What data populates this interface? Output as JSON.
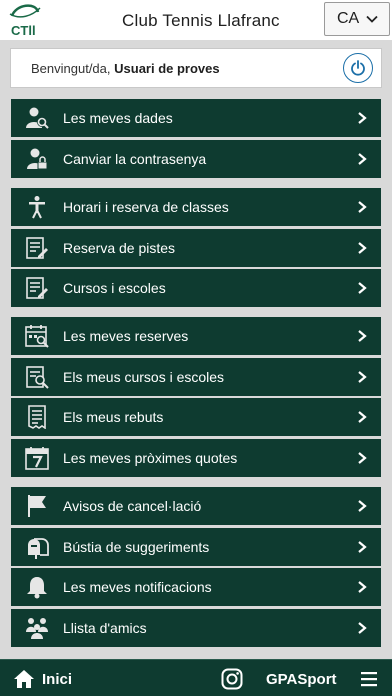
{
  "header": {
    "logo_text": "CTLl",
    "club_name": "Club Tennis Llafranc",
    "language": "CA"
  },
  "welcome": {
    "greeting": "Benvingut/da,",
    "user_name": "Usuari de proves"
  },
  "groups": [
    {
      "items": [
        {
          "label": "Les meves dades",
          "icon": "user-search-icon"
        },
        {
          "label": "Canviar la contrasenya",
          "icon": "user-lock-icon"
        }
      ]
    },
    {
      "items": [
        {
          "label": "Horari i reserva de classes",
          "icon": "trainer-icon"
        },
        {
          "label": "Reserva de pistes",
          "icon": "document-edit-icon"
        },
        {
          "label": "Cursos i escoles",
          "icon": "document-edit-icon"
        }
      ]
    },
    {
      "items": [
        {
          "label": "Les meves reserves",
          "icon": "calendar-search-icon"
        },
        {
          "label": "Els meus cursos i escoles",
          "icon": "document-search-icon"
        },
        {
          "label": "Els meus rebuts",
          "icon": "receipt-icon"
        },
        {
          "label": "Les meves pròximes quotes",
          "icon": "calendar-7-icon"
        }
      ]
    },
    {
      "items": [
        {
          "label": "Avisos de cancel·lació",
          "icon": "flag-icon"
        },
        {
          "label": "Bústia de suggeriments",
          "icon": "mailbox-icon"
        },
        {
          "label": "Les meves notificacions",
          "icon": "bell-icon"
        },
        {
          "label": "Llista d'amics",
          "icon": "friends-icon"
        }
      ]
    }
  ],
  "footer": {
    "home_label": "Inici",
    "brand_label": "GPASport"
  },
  "colors": {
    "menu_bg": "#0e3b30",
    "logo_green": "#1a6a48",
    "power_blue": "#1b6fa8"
  }
}
